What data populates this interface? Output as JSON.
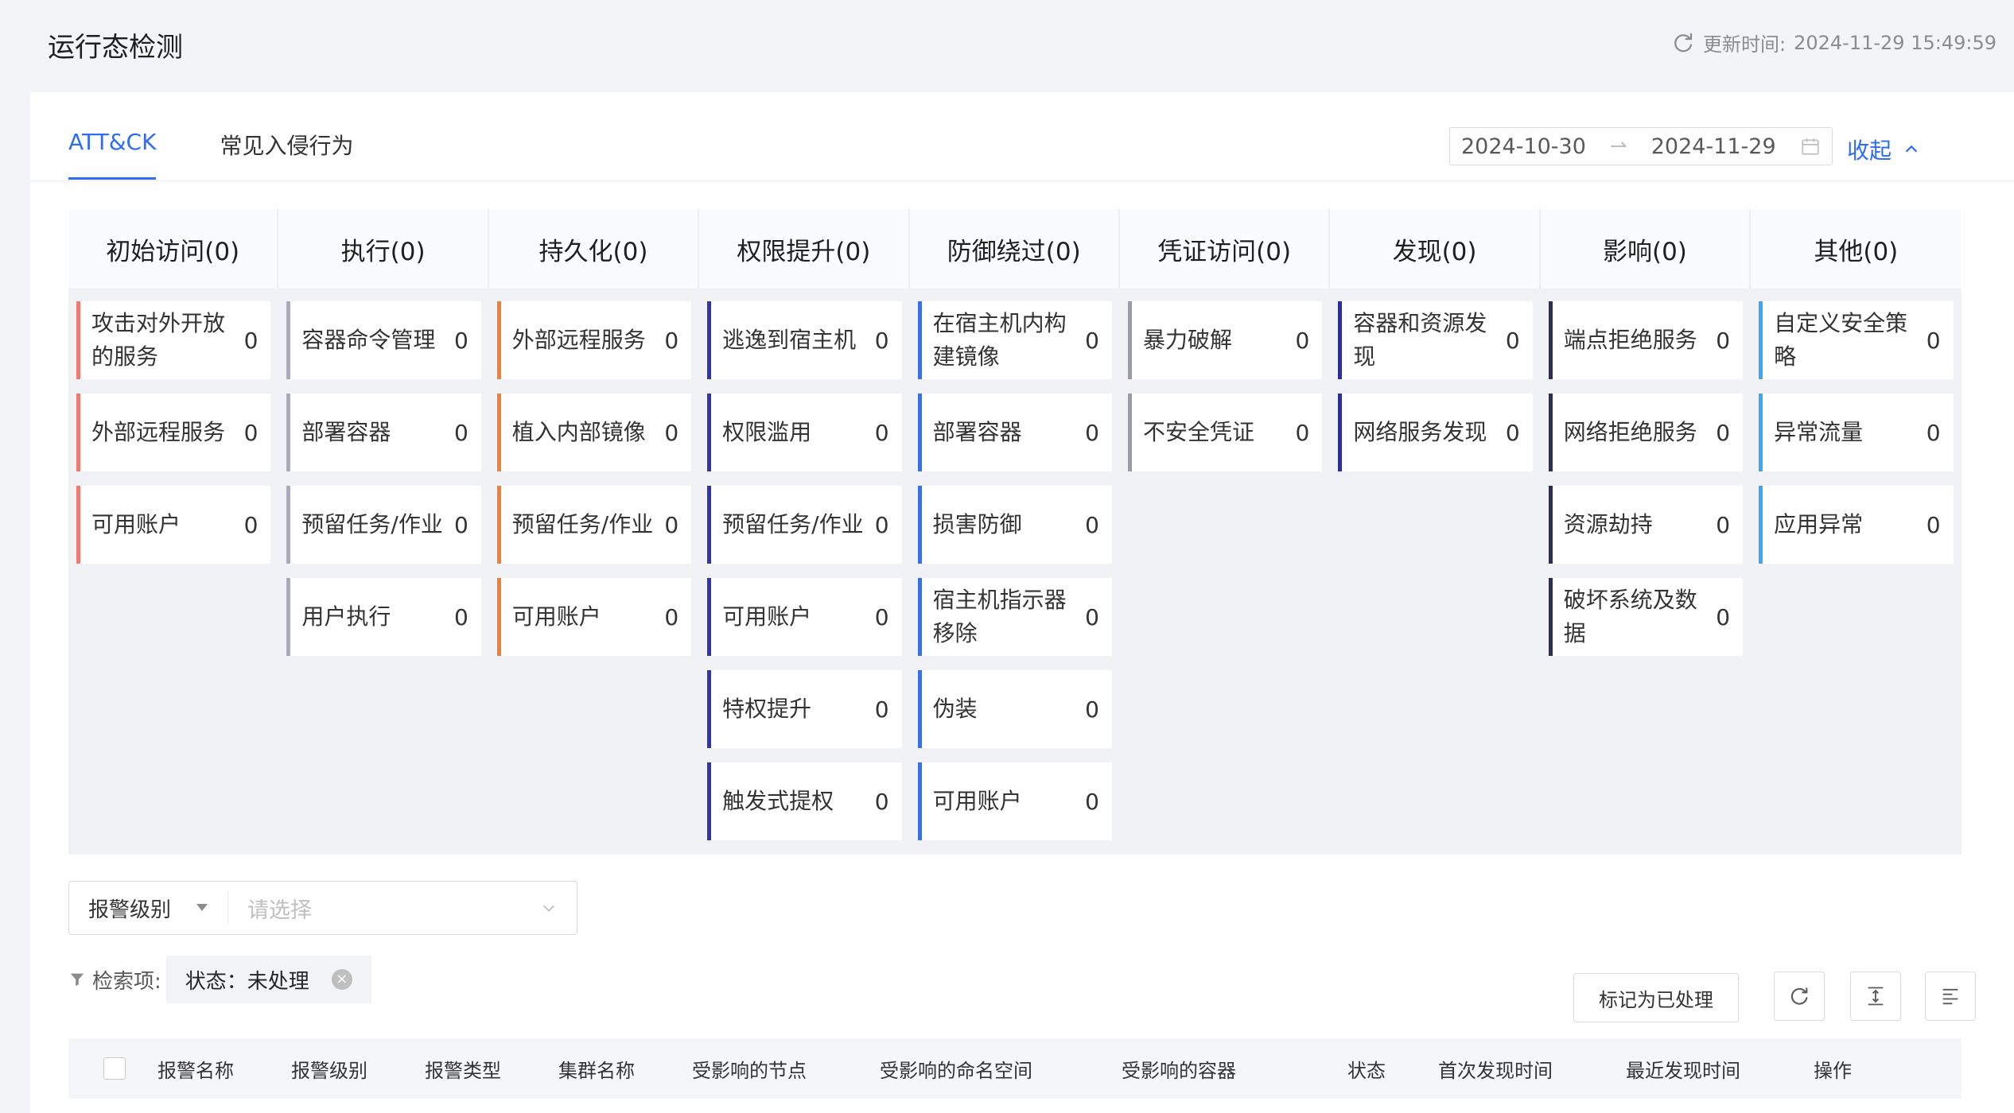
{
  "page": {
    "title": "运行态检测",
    "update_label": "更新时间:",
    "update_time": "2024-11-29 15:49:59"
  },
  "tabs": [
    {
      "label": "ATT&CK",
      "active": true
    },
    {
      "label": "常见入侵行为",
      "active": false
    }
  ],
  "date_range": {
    "start": "2024-10-30",
    "end": "2024-11-29"
  },
  "collapse_label": "收起",
  "matrix": [
    {
      "title": "初始访问(0)",
      "color": "#f07a73",
      "items": [
        {
          "label": "攻击对外开放的服务",
          "count": "0"
        },
        {
          "label": "外部远程服务",
          "count": "0"
        },
        {
          "label": "可用账户",
          "count": "0"
        }
      ]
    },
    {
      "title": "执行(0)",
      "color": "#a9abba",
      "items": [
        {
          "label": "容器命令管理",
          "count": "0"
        },
        {
          "label": "部署容器",
          "count": "0"
        },
        {
          "label": "预留任务/作业",
          "count": "0"
        },
        {
          "label": "用户执行",
          "count": "0"
        }
      ]
    },
    {
      "title": "持久化(0)",
      "color": "#f08033",
      "items": [
        {
          "label": "外部远程服务",
          "count": "0"
        },
        {
          "label": "植入内部镜像",
          "count": "0"
        },
        {
          "label": "预留任务/作业",
          "count": "0"
        },
        {
          "label": "可用账户",
          "count": "0"
        }
      ]
    },
    {
      "title": "权限提升(0)",
      "color": "#2e36a8",
      "items": [
        {
          "label": "逃逸到宿主机",
          "count": "0"
        },
        {
          "label": "权限滥用",
          "count": "0"
        },
        {
          "label": "预留任务/作业",
          "count": "0"
        },
        {
          "label": "可用账户",
          "count": "0"
        },
        {
          "label": "特权提升",
          "count": "0"
        },
        {
          "label": "触发式提权",
          "count": "0"
        }
      ]
    },
    {
      "title": "防御绕过(0)",
      "color": "#3c6fe0",
      "items": [
        {
          "label": "在宿主机内构建镜像",
          "count": "0"
        },
        {
          "label": "部署容器",
          "count": "0"
        },
        {
          "label": "损害防御",
          "count": "0"
        },
        {
          "label": "宿主机指示器移除",
          "count": "0"
        },
        {
          "label": "伪装",
          "count": "0"
        },
        {
          "label": "可用账户",
          "count": "0"
        }
      ]
    },
    {
      "title": "凭证访问(0)",
      "color": "#9a9ca8",
      "items": [
        {
          "label": "暴力破解",
          "count": "0"
        },
        {
          "label": "不安全凭证",
          "count": "0"
        }
      ]
    },
    {
      "title": "发现(0)",
      "color": "#2a2f9a",
      "items": [
        {
          "label": "容器和资源发现",
          "count": "0"
        },
        {
          "label": "网络服务发现",
          "count": "0"
        }
      ]
    },
    {
      "title": "影响(0)",
      "color": "#2b3050",
      "items": [
        {
          "label": "端点拒绝服务",
          "count": "0"
        },
        {
          "label": "网络拒绝服务",
          "count": "0"
        },
        {
          "label": "资源劫持",
          "count": "0"
        },
        {
          "label": "破坏系统及数据",
          "count": "0"
        }
      ]
    },
    {
      "title": "其他(0)",
      "color": "#3ba9ef",
      "items": [
        {
          "label": "自定义安全策略",
          "count": "0"
        },
        {
          "label": "异常流量",
          "count": "0"
        },
        {
          "label": "应用异常",
          "count": "0"
        }
      ]
    }
  ],
  "filter": {
    "type_label": "报警级别",
    "placeholder": "请选择"
  },
  "mark_button": "标记为已处理",
  "search": {
    "label": "检索项:",
    "chip": "状态：未处理"
  },
  "table": {
    "columns": [
      "报警名称",
      "报警级别",
      "报警类型",
      "集群名称",
      "受影响的节点",
      "受影响的命名空间",
      "受影响的容器",
      "状态",
      "首次发现时间",
      "最近发现时间",
      "操作"
    ]
  }
}
